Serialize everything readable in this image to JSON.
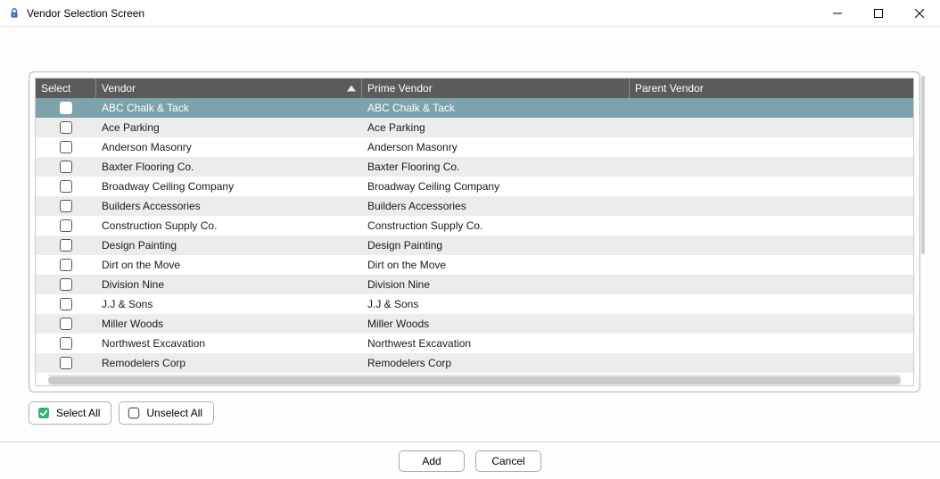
{
  "window": {
    "title": "Vendor Selection Screen"
  },
  "columns": {
    "select": "Select",
    "vendor": "Vendor",
    "prime": "Prime Vendor",
    "parent": "Parent Vendor",
    "sorted": "vendor",
    "sort_dir": "asc"
  },
  "rows": [
    {
      "vendor": "ABC Chalk & Tack",
      "prime": "ABC Chalk & Tack",
      "parent": "",
      "selected": true,
      "checked": false
    },
    {
      "vendor": "Ace Parking",
      "prime": "Ace Parking",
      "parent": "",
      "selected": false,
      "checked": false
    },
    {
      "vendor": "Anderson Masonry",
      "prime": "Anderson Masonry",
      "parent": "",
      "selected": false,
      "checked": false
    },
    {
      "vendor": "Baxter Flooring Co.",
      "prime": "Baxter Flooring Co.",
      "parent": "",
      "selected": false,
      "checked": false
    },
    {
      "vendor": "Broadway Ceiling Company",
      "prime": "Broadway Ceiling Company",
      "parent": "",
      "selected": false,
      "checked": false
    },
    {
      "vendor": "Builders Accessories",
      "prime": "Builders Accessories",
      "parent": "",
      "selected": false,
      "checked": false
    },
    {
      "vendor": "Construction Supply Co.",
      "prime": "Construction Supply Co.",
      "parent": "",
      "selected": false,
      "checked": false
    },
    {
      "vendor": "Design Painting",
      "prime": "Design Painting",
      "parent": "",
      "selected": false,
      "checked": false
    },
    {
      "vendor": "Dirt on the Move",
      "prime": "Dirt on the Move",
      "parent": "",
      "selected": false,
      "checked": false
    },
    {
      "vendor": "Division Nine",
      "prime": "Division Nine",
      "parent": "",
      "selected": false,
      "checked": false
    },
    {
      "vendor": "J.J & Sons",
      "prime": "J.J & Sons",
      "parent": "",
      "selected": false,
      "checked": false
    },
    {
      "vendor": "Miller Woods",
      "prime": "Miller Woods",
      "parent": "",
      "selected": false,
      "checked": false
    },
    {
      "vendor": "Northwest Excavation",
      "prime": "Northwest Excavation",
      "parent": "",
      "selected": false,
      "checked": false
    },
    {
      "vendor": "Remodelers Corp",
      "prime": "Remodelers Corp",
      "parent": "",
      "selected": false,
      "checked": false
    }
  ],
  "buttons": {
    "select_all": "Select All",
    "unselect_all": "Unselect All",
    "add": "Add",
    "cancel": "Cancel"
  }
}
